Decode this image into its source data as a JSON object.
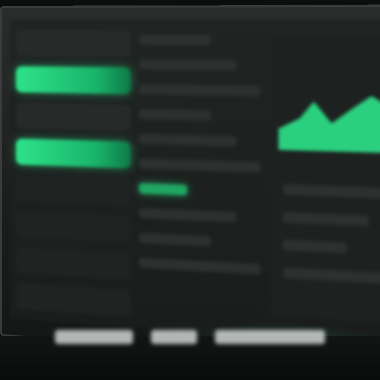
{
  "window": {
    "title": ""
  },
  "sidebar": {
    "items": [
      {
        "label": "",
        "state": "normal"
      },
      {
        "label": "",
        "state": "active"
      },
      {
        "label": "",
        "state": "normal"
      },
      {
        "label": "",
        "state": "active"
      },
      {
        "label": "",
        "state": "dim"
      },
      {
        "label": "",
        "state": "dim"
      },
      {
        "label": "",
        "state": "dim"
      },
      {
        "label": "",
        "state": "dim"
      }
    ]
  },
  "main": {
    "list_rows": 10
  },
  "right_pane": {
    "chart_color": "#2ee38a",
    "rows": [
      "",
      "",
      "",
      ""
    ]
  },
  "caption": {
    "segments": [
      "",
      "",
      ""
    ]
  },
  "colors": {
    "accent": "#2ee38a",
    "accent_dark": "#19b56a",
    "background": "#0b0e0d",
    "panel": "#1d2120"
  }
}
